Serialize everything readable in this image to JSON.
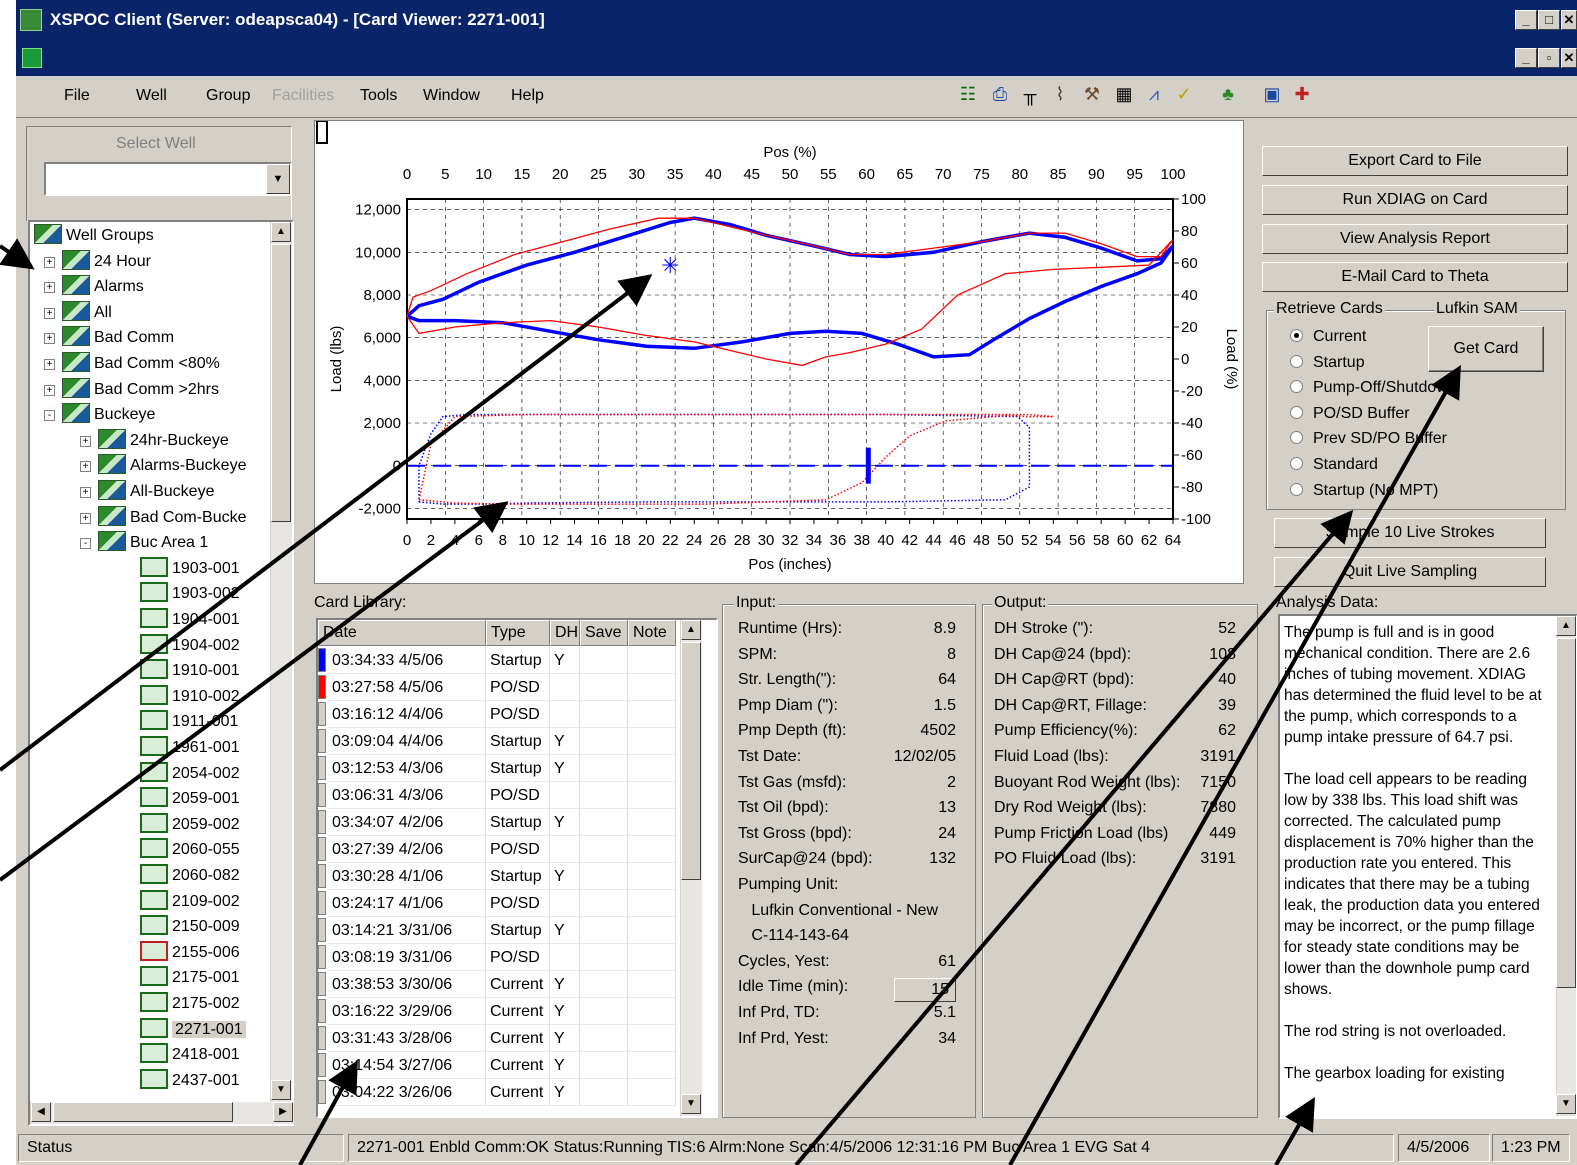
{
  "window": {
    "title": "XSPOC Client (Server: odeapsca04) - [Card Viewer: 2271-001]"
  },
  "menu": [
    "File",
    "Well",
    "Group",
    "Facilities",
    "Tools",
    "Window",
    "Help"
  ],
  "menu_disabled": "Facilities",
  "toolbar_icons": [
    "connect-icon",
    "printer-icon",
    "comb-icon",
    "bug-icon",
    "wrench-icon",
    "table-icon",
    "chart-icon",
    "check-icon",
    "tree-icon",
    "analysis-icon",
    "split-icon"
  ],
  "left": {
    "select_label": "Select Well",
    "combo_value": "",
    "tree": [
      {
        "label": "Well Groups",
        "level": 0,
        "kind": "root"
      },
      {
        "label": "24 Hour",
        "level": 1,
        "kind": "group",
        "exp": "+"
      },
      {
        "label": "Alarms",
        "level": 1,
        "kind": "group",
        "exp": "+"
      },
      {
        "label": "All",
        "level": 1,
        "kind": "group",
        "exp": "+"
      },
      {
        "label": "Bad Comm",
        "level": 1,
        "kind": "group",
        "exp": "+"
      },
      {
        "label": "Bad Comm <80%",
        "level": 1,
        "kind": "group",
        "exp": "+"
      },
      {
        "label": "Bad Comm >2hrs",
        "level": 1,
        "kind": "group",
        "exp": "+"
      },
      {
        "label": "Buckeye",
        "level": 1,
        "kind": "group",
        "exp": "-"
      },
      {
        "label": "24hr-Buckeye",
        "level": 2,
        "kind": "group",
        "exp": "+"
      },
      {
        "label": "Alarms-Buckeye",
        "level": 2,
        "kind": "group",
        "exp": "+"
      },
      {
        "label": "All-Buckeye",
        "level": 2,
        "kind": "group",
        "exp": "+"
      },
      {
        "label": "Bad Com-Bucke",
        "level": 2,
        "kind": "group",
        "exp": "+"
      },
      {
        "label": "Buc Area 1",
        "level": 2,
        "kind": "group",
        "exp": "-"
      },
      {
        "label": "1903-001",
        "level": 3,
        "kind": "well"
      },
      {
        "label": "1903-002",
        "level": 3,
        "kind": "well"
      },
      {
        "label": "1904-001",
        "level": 3,
        "kind": "well"
      },
      {
        "label": "1904-002",
        "level": 3,
        "kind": "well"
      },
      {
        "label": "1910-001",
        "level": 3,
        "kind": "well"
      },
      {
        "label": "1910-002",
        "level": 3,
        "kind": "well"
      },
      {
        "label": "1911-001",
        "level": 3,
        "kind": "well"
      },
      {
        "label": "1961-001",
        "level": 3,
        "kind": "well"
      },
      {
        "label": "2054-002",
        "level": 3,
        "kind": "well"
      },
      {
        "label": "2059-001",
        "level": 3,
        "kind": "well"
      },
      {
        "label": "2059-002",
        "level": 3,
        "kind": "well"
      },
      {
        "label": "2060-055",
        "level": 3,
        "kind": "well"
      },
      {
        "label": "2060-082",
        "level": 3,
        "kind": "well"
      },
      {
        "label": "2109-002",
        "level": 3,
        "kind": "well"
      },
      {
        "label": "2150-009",
        "level": 3,
        "kind": "well"
      },
      {
        "label": "2155-006",
        "level": 3,
        "kind": "well",
        "alarm": true
      },
      {
        "label": "2175-001",
        "level": 3,
        "kind": "well"
      },
      {
        "label": "2175-002",
        "level": 3,
        "kind": "well"
      },
      {
        "label": "2271-001",
        "level": 3,
        "kind": "well",
        "selected": true
      },
      {
        "label": "2418-001",
        "level": 3,
        "kind": "well"
      },
      {
        "label": "2437-001",
        "level": 3,
        "kind": "well"
      }
    ]
  },
  "chart_data": {
    "type": "line",
    "title": "",
    "top_xlabel": "Pos (%)",
    "bottom_xlabel": "Pos (inches)",
    "ylabel": "Load (lbs)",
    "y2label": "Load (%)",
    "top_ticks": [
      "0",
      "5",
      "10",
      "15",
      "20",
      "25",
      "30",
      "35",
      "40",
      "45",
      "50",
      "55",
      "60",
      "65",
      "70",
      "75",
      "80",
      "85",
      "90",
      "95",
      "100"
    ],
    "bottom_ticks": [
      "0",
      "2",
      "4",
      "6",
      "8",
      "10",
      "12",
      "14",
      "16",
      "18",
      "20",
      "22",
      "24",
      "26",
      "28",
      "30",
      "32",
      "34",
      "36",
      "38",
      "40",
      "42",
      "44",
      "46",
      "48",
      "50",
      "52",
      "54",
      "56",
      "58",
      "60",
      "62",
      "64"
    ],
    "left_ticks": [
      "12,000",
      "10,000",
      "8,000",
      "6,000",
      "4,000",
      "2,000",
      "0",
      "-2,000"
    ],
    "right_ticks": [
      "100",
      "80",
      "60",
      "40",
      "20",
      "0",
      "-20",
      "-40",
      "-60",
      "-80",
      "-100"
    ],
    "xlim": [
      0,
      64
    ],
    "ylim": [
      -2500,
      12500
    ],
    "grid": true,
    "series": [
      {
        "color": "#0000ff",
        "style": "thick",
        "points": [
          [
            0,
            7000
          ],
          [
            1,
            7500
          ],
          [
            3,
            7800
          ],
          [
            6,
            8600
          ],
          [
            10,
            9400
          ],
          [
            14,
            10000
          ],
          [
            18,
            10700
          ],
          [
            22,
            11400
          ],
          [
            24,
            11600
          ],
          [
            27,
            11300
          ],
          [
            30,
            10800
          ],
          [
            34,
            10300
          ],
          [
            37,
            9900
          ],
          [
            40,
            9800
          ],
          [
            44,
            10000
          ],
          [
            48,
            10500
          ],
          [
            52,
            10900
          ],
          [
            55,
            10700
          ],
          [
            58,
            10200
          ],
          [
            61,
            9600
          ],
          [
            63,
            9700
          ],
          [
            64,
            10300
          ],
          [
            63,
            9500
          ],
          [
            61,
            9000
          ],
          [
            58,
            8400
          ],
          [
            55,
            7700
          ],
          [
            52,
            6900
          ],
          [
            49,
            5900
          ],
          [
            47,
            5200
          ],
          [
            44,
            5100
          ],
          [
            41,
            5700
          ],
          [
            38,
            6200
          ],
          [
            35,
            6300
          ],
          [
            32,
            6200
          ],
          [
            28,
            5800
          ],
          [
            24,
            5500
          ],
          [
            20,
            5600
          ],
          [
            16,
            5900
          ],
          [
            12,
            6300
          ],
          [
            8,
            6700
          ],
          [
            4,
            6800
          ],
          [
            1,
            6800
          ],
          [
            0,
            7000
          ]
        ]
      },
      {
        "color": "#ff0000",
        "style": "thin",
        "points": [
          [
            0,
            7000
          ],
          [
            0.5,
            7900
          ],
          [
            2,
            8200
          ],
          [
            5,
            9000
          ],
          [
            9,
            9900
          ],
          [
            13,
            10500
          ],
          [
            17,
            11100
          ],
          [
            21,
            11600
          ],
          [
            24,
            11600
          ],
          [
            27,
            11200
          ],
          [
            30,
            10800
          ],
          [
            34,
            10300
          ],
          [
            37,
            9900
          ],
          [
            40,
            9900
          ],
          [
            44,
            10200
          ],
          [
            48,
            10500
          ],
          [
            52,
            10900
          ],
          [
            55,
            10900
          ],
          [
            58,
            10400
          ],
          [
            61,
            9800
          ],
          [
            63,
            9800
          ],
          [
            64,
            10600
          ],
          [
            62,
            9400
          ],
          [
            58,
            9300
          ],
          [
            54,
            9200
          ],
          [
            50,
            9000
          ],
          [
            46,
            8000
          ],
          [
            43,
            6400
          ],
          [
            40,
            5700
          ],
          [
            37,
            5300
          ],
          [
            35,
            5100
          ],
          [
            33,
            4700
          ],
          [
            30,
            5000
          ],
          [
            27,
            5400
          ],
          [
            24,
            5800
          ],
          [
            20,
            6100
          ],
          [
            16,
            6500
          ],
          [
            12,
            6800
          ],
          [
            8,
            6700
          ],
          [
            4,
            6500
          ],
          [
            1,
            6200
          ],
          [
            0,
            7000
          ]
        ]
      },
      {
        "color": "#0000ff",
        "style": "dotted",
        "points": [
          [
            1,
            -1700
          ],
          [
            3,
            -1800
          ],
          [
            6,
            -1800
          ],
          [
            10,
            -1750
          ],
          [
            20,
            -1700
          ],
          [
            40,
            -1700
          ],
          [
            50,
            -1600
          ],
          [
            52,
            -1000
          ],
          [
            52,
            1800
          ],
          [
            51,
            2300
          ],
          [
            40,
            2400
          ],
          [
            20,
            2400
          ],
          [
            5,
            2400
          ],
          [
            3,
            2300
          ],
          [
            2,
            1500
          ],
          [
            1,
            0
          ],
          [
            1,
            -1700
          ]
        ]
      },
      {
        "color": "#ff0000",
        "style": "dotted",
        "points": [
          [
            1,
            -1600
          ],
          [
            4,
            -1750
          ],
          [
            8,
            -1800
          ],
          [
            15,
            -1800
          ],
          [
            25,
            -1800
          ],
          [
            35,
            -1600
          ],
          [
            38,
            -800
          ],
          [
            40,
            400
          ],
          [
            42,
            1400
          ],
          [
            45,
            2100
          ],
          [
            50,
            2350
          ],
          [
            52,
            2300
          ],
          [
            54,
            2300
          ],
          [
            52,
            2400
          ],
          [
            30,
            2400
          ],
          [
            10,
            2400
          ],
          [
            4,
            2300
          ],
          [
            2,
            1000
          ],
          [
            1,
            -1600
          ]
        ]
      },
      {
        "color": "#0000ff",
        "style": "dashed",
        "points": [
          [
            0,
            0
          ],
          [
            64,
            0
          ]
        ]
      }
    ],
    "markers": [
      {
        "color": "#0000ff",
        "type": "star",
        "x": 22,
        "y": 9400
      },
      {
        "color": "#0000ff",
        "type": "bar",
        "x": 38.5,
        "y": 0
      }
    ]
  },
  "right": {
    "buttons": [
      "Export Card to File",
      "Run XDIAG on Card",
      "View Analysis Report",
      "E-Mail Card to Theta"
    ],
    "retrieve_title": "Retrieve Cards",
    "lufkin_title": "Lufkin SAM",
    "radios": [
      {
        "label": "Current",
        "checked": true
      },
      {
        "label": "Startup",
        "checked": false
      },
      {
        "label": "Pump-Off/Shutdown",
        "checked": false
      },
      {
        "label": "PO/SD Buffer",
        "checked": false
      },
      {
        "label": "Prev SD/PO Buffer",
        "checked": false
      },
      {
        "label": "Standard",
        "checked": false
      },
      {
        "label": "Startup (No MPT)",
        "checked": false
      }
    ],
    "get_card": "Get Card",
    "sample": "Sample 10 Live Strokes",
    "quit": "Quit Live Sampling",
    "analysis_label": "Analysis Data:",
    "analysis_paragraphs": [
      "The pump is full and is in good mechanical condition.  There are 2.6 inches of tubing movement. XDIAG has determined the fluid level to be at the pump, which corresponds to a pump intake pressure of 64.7 psi.",
      "The load cell appears to be reading low by 338 lbs.  This load shift was corrected.  The calculated pump displacement is 70% higher than the production rate you entered.  This indicates that there may be a tubing leak, the production data you entered may be incorrect, or the pump fillage for steady state conditions may be lower than the downhole pump card shows.",
      "The rod string is not overloaded.",
      "The gearbox loading for existing"
    ]
  },
  "library": {
    "label": "Card Library:",
    "headers": [
      "Date",
      "Type",
      "DH",
      "Save",
      "Note"
    ],
    "rows": [
      {
        "date": "03:34:33 4/5/06",
        "type": "Startup",
        "dh": "Y",
        "marker": "#0000ff"
      },
      {
        "date": "03:27:58 4/5/06",
        "type": "PO/SD",
        "dh": "",
        "marker": "#ff0000"
      },
      {
        "date": "03:16:12 4/4/06",
        "type": "PO/SD",
        "dh": "",
        "marker": ""
      },
      {
        "date": "03:09:04 4/4/06",
        "type": "Startup",
        "dh": "Y",
        "marker": ""
      },
      {
        "date": "03:12:53 4/3/06",
        "type": "Startup",
        "dh": "Y",
        "marker": ""
      },
      {
        "date": "03:06:31 4/3/06",
        "type": "PO/SD",
        "dh": "",
        "marker": ""
      },
      {
        "date": "03:34:07 4/2/06",
        "type": "Startup",
        "dh": "Y",
        "marker": ""
      },
      {
        "date": "03:27:39 4/2/06",
        "type": "PO/SD",
        "dh": "",
        "marker": ""
      },
      {
        "date": "03:30:28 4/1/06",
        "type": "Startup",
        "dh": "Y",
        "marker": ""
      },
      {
        "date": "03:24:17 4/1/06",
        "type": "PO/SD",
        "dh": "",
        "marker": ""
      },
      {
        "date": "03:14:21 3/31/06",
        "type": "Startup",
        "dh": "Y",
        "marker": ""
      },
      {
        "date": "03:08:19 3/31/06",
        "type": "PO/SD",
        "dh": "",
        "marker": ""
      },
      {
        "date": "03:38:53 3/30/06",
        "type": "Current",
        "dh": "Y",
        "marker": ""
      },
      {
        "date": "03:16:22 3/29/06",
        "type": "Current",
        "dh": "Y",
        "marker": ""
      },
      {
        "date": "03:31:43 3/28/06",
        "type": "Current",
        "dh": "Y",
        "marker": ""
      },
      {
        "date": "03:14:54 3/27/06",
        "type": "Current",
        "dh": "Y",
        "marker": ""
      },
      {
        "date": "03:04:22 3/26/06",
        "type": "Current",
        "dh": "Y",
        "marker": ""
      }
    ]
  },
  "input": {
    "title": "Input:",
    "rows": [
      [
        "Runtime (Hrs):",
        "8.9"
      ],
      [
        "SPM:",
        "8"
      ],
      [
        "Str. Length(\"):",
        "64"
      ],
      [
        "Pmp Diam (\"):",
        "1.5"
      ],
      [
        "Pmp Depth (ft):",
        "4502"
      ],
      [
        "Tst Date:",
        "12/02/05"
      ],
      [
        "Tst Gas (msfd):",
        "2"
      ],
      [
        "Tst Oil (bpd):",
        "13"
      ],
      [
        "Tst Gross (bpd):",
        "24"
      ],
      [
        "SurCap@24 (bpd):",
        "132"
      ],
      [
        "Pumping Unit:",
        ""
      ],
      [
        "   Lufkin Conventional - New",
        ""
      ],
      [
        "   C-114-143-64",
        ""
      ],
      [
        "Cycles, Yest:",
        "61"
      ],
      [
        "Idle Time (min):",
        "15"
      ],
      [
        "Inf Prd, TD:",
        "5.1"
      ],
      [
        "Inf Prd, Yest:",
        "34"
      ]
    ]
  },
  "output": {
    "title": "Output:",
    "rows": [
      [
        "DH Stroke (\"):",
        "52"
      ],
      [
        "DH Cap@24 (bpd):",
        "108"
      ],
      [
        "DH Cap@RT (bpd):",
        "40"
      ],
      [
        "DH Cap@RT, Fillage:",
        "39"
      ],
      [
        "Pump Efficiency(%):",
        "62"
      ],
      [
        "Fluid Load (lbs):",
        "3191"
      ],
      [
        "Buoyant Rod Weight (lbs):",
        "7150"
      ],
      [
        "Dry Rod Weight (lbs):",
        "7880"
      ],
      [
        "Pump Friction Load (lbs)",
        "449"
      ],
      [
        "PO Fluid Load (lbs):",
        "3191"
      ]
    ]
  },
  "status": {
    "left": "Status",
    "middle": "2271-001 Enbld  Comm:OK  Status:Running  TIS:6  Alrm:None  Scan:4/5/2006 12:31:16 PM  Buc Area 1 EVG Sat 4",
    "date": "4/5/2006",
    "time": "1:23 PM"
  }
}
